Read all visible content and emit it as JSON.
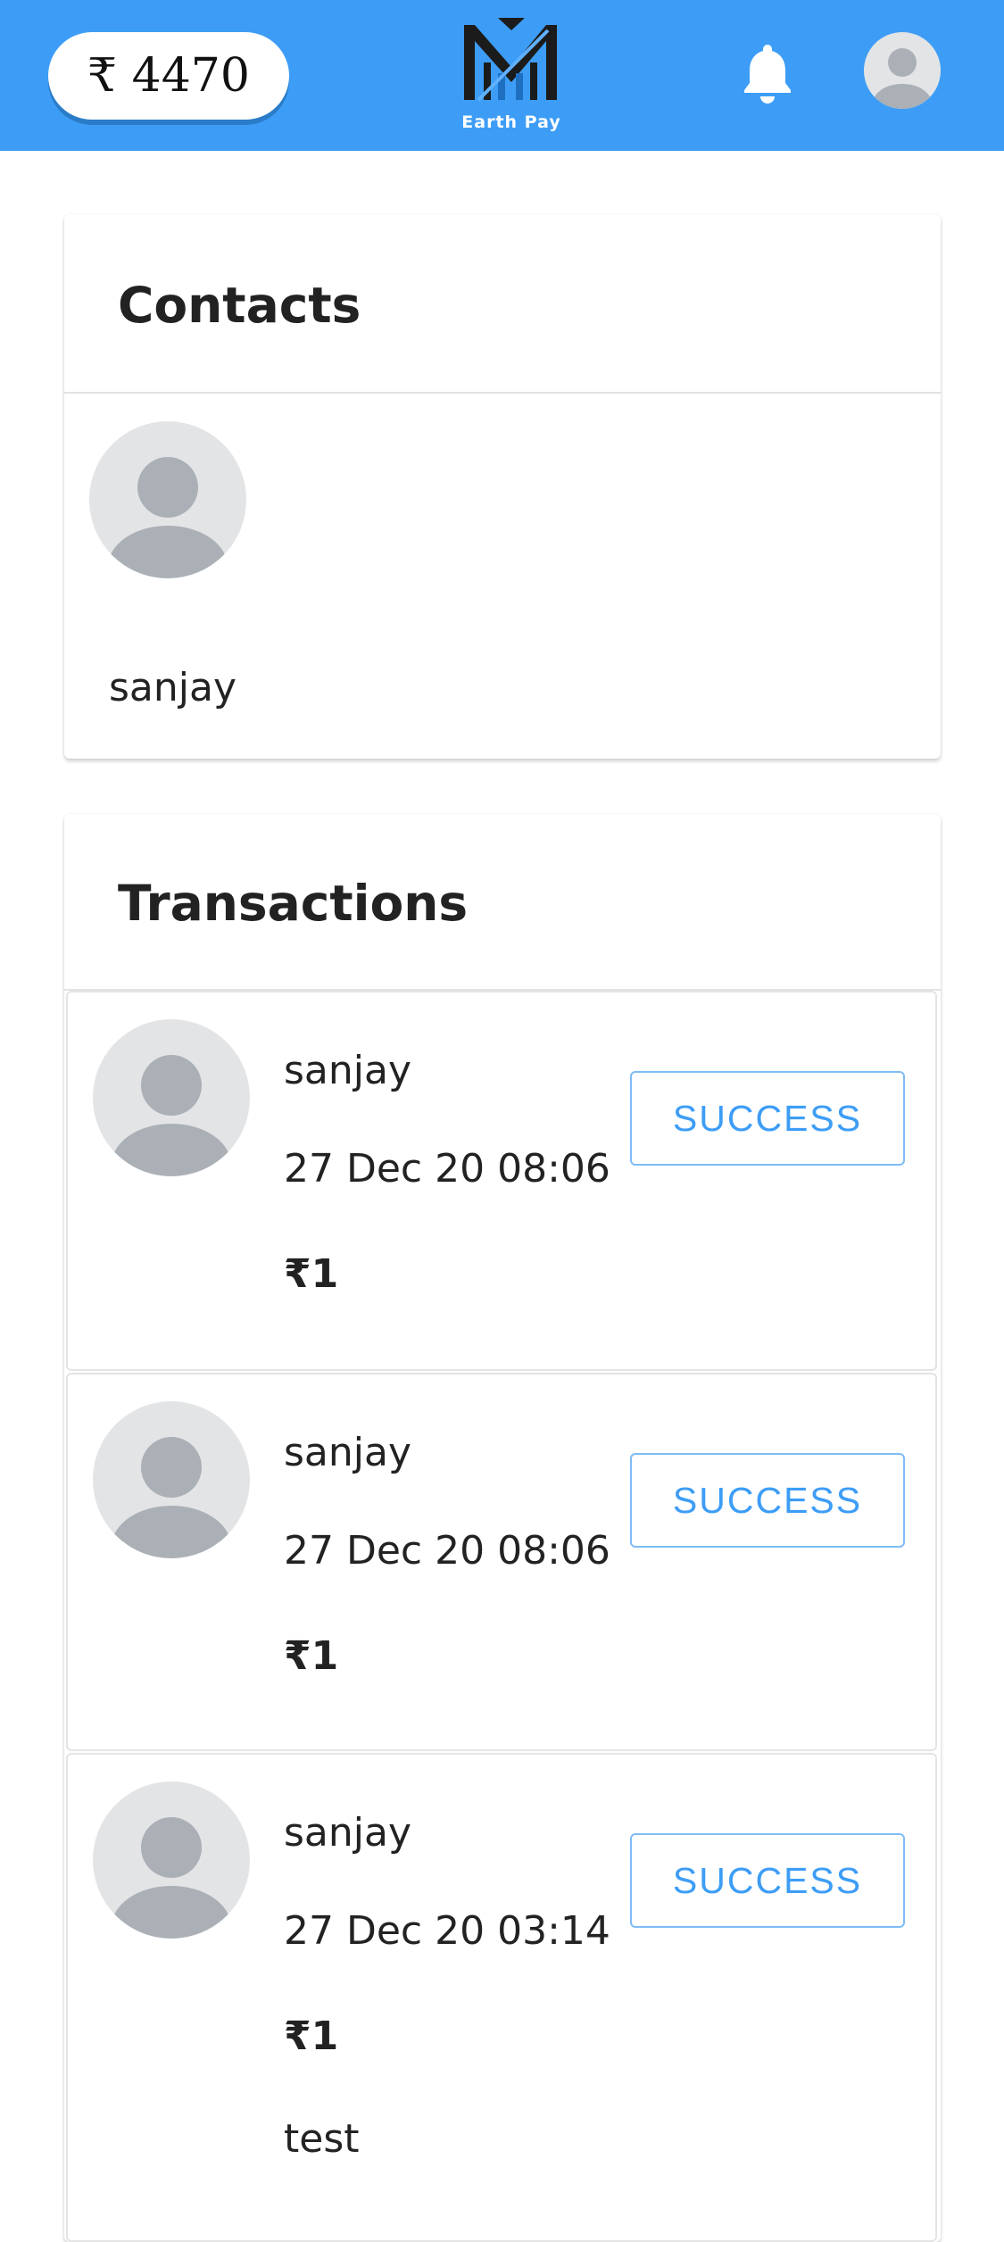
{
  "header": {
    "balance": "₹ 4470",
    "logo_text": "Earth Pay",
    "bell_icon": "bell-icon",
    "avatar_icon": "user-avatar-icon",
    "brand_color": "#3d9df6"
  },
  "contacts": {
    "title": "Contacts",
    "items": [
      {
        "name": "sanjay",
        "icon": "user-avatar-icon"
      }
    ]
  },
  "transactions": {
    "title": "Transactions",
    "items": [
      {
        "name": "sanjay",
        "date": "27 Dec 20 08:06",
        "amount": "₹1",
        "status": "SUCCESS"
      },
      {
        "name": "sanjay",
        "date": "27 Dec 20 08:06",
        "amount": "₹1",
        "status": "SUCCESS"
      },
      {
        "name": "sanjay",
        "date": "27 Dec 20 03:14",
        "amount": "₹1",
        "status": "SUCCESS",
        "note": "test"
      }
    ]
  }
}
